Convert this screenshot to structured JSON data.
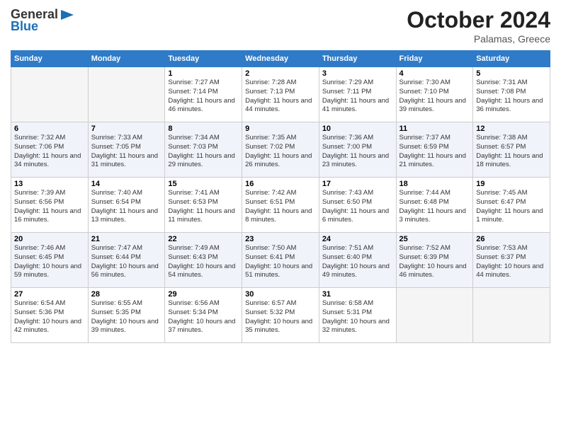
{
  "header": {
    "logo_line1": "General",
    "logo_line2": "Blue",
    "month": "October 2024",
    "location": "Palamas, Greece"
  },
  "days_of_week": [
    "Sunday",
    "Monday",
    "Tuesday",
    "Wednesday",
    "Thursday",
    "Friday",
    "Saturday"
  ],
  "weeks": [
    [
      {
        "day": "",
        "sunrise": "",
        "sunset": "",
        "daylight": ""
      },
      {
        "day": "",
        "sunrise": "",
        "sunset": "",
        "daylight": ""
      },
      {
        "day": "1",
        "sunrise": "Sunrise: 7:27 AM",
        "sunset": "Sunset: 7:14 PM",
        "daylight": "Daylight: 11 hours and 46 minutes."
      },
      {
        "day": "2",
        "sunrise": "Sunrise: 7:28 AM",
        "sunset": "Sunset: 7:13 PM",
        "daylight": "Daylight: 11 hours and 44 minutes."
      },
      {
        "day": "3",
        "sunrise": "Sunrise: 7:29 AM",
        "sunset": "Sunset: 7:11 PM",
        "daylight": "Daylight: 11 hours and 41 minutes."
      },
      {
        "day": "4",
        "sunrise": "Sunrise: 7:30 AM",
        "sunset": "Sunset: 7:10 PM",
        "daylight": "Daylight: 11 hours and 39 minutes."
      },
      {
        "day": "5",
        "sunrise": "Sunrise: 7:31 AM",
        "sunset": "Sunset: 7:08 PM",
        "daylight": "Daylight: 11 hours and 36 minutes."
      }
    ],
    [
      {
        "day": "6",
        "sunrise": "Sunrise: 7:32 AM",
        "sunset": "Sunset: 7:06 PM",
        "daylight": "Daylight: 11 hours and 34 minutes."
      },
      {
        "day": "7",
        "sunrise": "Sunrise: 7:33 AM",
        "sunset": "Sunset: 7:05 PM",
        "daylight": "Daylight: 11 hours and 31 minutes."
      },
      {
        "day": "8",
        "sunrise": "Sunrise: 7:34 AM",
        "sunset": "Sunset: 7:03 PM",
        "daylight": "Daylight: 11 hours and 29 minutes."
      },
      {
        "day": "9",
        "sunrise": "Sunrise: 7:35 AM",
        "sunset": "Sunset: 7:02 PM",
        "daylight": "Daylight: 11 hours and 26 minutes."
      },
      {
        "day": "10",
        "sunrise": "Sunrise: 7:36 AM",
        "sunset": "Sunset: 7:00 PM",
        "daylight": "Daylight: 11 hours and 23 minutes."
      },
      {
        "day": "11",
        "sunrise": "Sunrise: 7:37 AM",
        "sunset": "Sunset: 6:59 PM",
        "daylight": "Daylight: 11 hours and 21 minutes."
      },
      {
        "day": "12",
        "sunrise": "Sunrise: 7:38 AM",
        "sunset": "Sunset: 6:57 PM",
        "daylight": "Daylight: 11 hours and 18 minutes."
      }
    ],
    [
      {
        "day": "13",
        "sunrise": "Sunrise: 7:39 AM",
        "sunset": "Sunset: 6:56 PM",
        "daylight": "Daylight: 11 hours and 16 minutes."
      },
      {
        "day": "14",
        "sunrise": "Sunrise: 7:40 AM",
        "sunset": "Sunset: 6:54 PM",
        "daylight": "Daylight: 11 hours and 13 minutes."
      },
      {
        "day": "15",
        "sunrise": "Sunrise: 7:41 AM",
        "sunset": "Sunset: 6:53 PM",
        "daylight": "Daylight: 11 hours and 11 minutes."
      },
      {
        "day": "16",
        "sunrise": "Sunrise: 7:42 AM",
        "sunset": "Sunset: 6:51 PM",
        "daylight": "Daylight: 11 hours and 8 minutes."
      },
      {
        "day": "17",
        "sunrise": "Sunrise: 7:43 AM",
        "sunset": "Sunset: 6:50 PM",
        "daylight": "Daylight: 11 hours and 6 minutes."
      },
      {
        "day": "18",
        "sunrise": "Sunrise: 7:44 AM",
        "sunset": "Sunset: 6:48 PM",
        "daylight": "Daylight: 11 hours and 3 minutes."
      },
      {
        "day": "19",
        "sunrise": "Sunrise: 7:45 AM",
        "sunset": "Sunset: 6:47 PM",
        "daylight": "Daylight: 11 hours and 1 minute."
      }
    ],
    [
      {
        "day": "20",
        "sunrise": "Sunrise: 7:46 AM",
        "sunset": "Sunset: 6:45 PM",
        "daylight": "Daylight: 10 hours and 59 minutes."
      },
      {
        "day": "21",
        "sunrise": "Sunrise: 7:47 AM",
        "sunset": "Sunset: 6:44 PM",
        "daylight": "Daylight: 10 hours and 56 minutes."
      },
      {
        "day": "22",
        "sunrise": "Sunrise: 7:49 AM",
        "sunset": "Sunset: 6:43 PM",
        "daylight": "Daylight: 10 hours and 54 minutes."
      },
      {
        "day": "23",
        "sunrise": "Sunrise: 7:50 AM",
        "sunset": "Sunset: 6:41 PM",
        "daylight": "Daylight: 10 hours and 51 minutes."
      },
      {
        "day": "24",
        "sunrise": "Sunrise: 7:51 AM",
        "sunset": "Sunset: 6:40 PM",
        "daylight": "Daylight: 10 hours and 49 minutes."
      },
      {
        "day": "25",
        "sunrise": "Sunrise: 7:52 AM",
        "sunset": "Sunset: 6:39 PM",
        "daylight": "Daylight: 10 hours and 46 minutes."
      },
      {
        "day": "26",
        "sunrise": "Sunrise: 7:53 AM",
        "sunset": "Sunset: 6:37 PM",
        "daylight": "Daylight: 10 hours and 44 minutes."
      }
    ],
    [
      {
        "day": "27",
        "sunrise": "Sunrise: 6:54 AM",
        "sunset": "Sunset: 5:36 PM",
        "daylight": "Daylight: 10 hours and 42 minutes."
      },
      {
        "day": "28",
        "sunrise": "Sunrise: 6:55 AM",
        "sunset": "Sunset: 5:35 PM",
        "daylight": "Daylight: 10 hours and 39 minutes."
      },
      {
        "day": "29",
        "sunrise": "Sunrise: 6:56 AM",
        "sunset": "Sunset: 5:34 PM",
        "daylight": "Daylight: 10 hours and 37 minutes."
      },
      {
        "day": "30",
        "sunrise": "Sunrise: 6:57 AM",
        "sunset": "Sunset: 5:32 PM",
        "daylight": "Daylight: 10 hours and 35 minutes."
      },
      {
        "day": "31",
        "sunrise": "Sunrise: 6:58 AM",
        "sunset": "Sunset: 5:31 PM",
        "daylight": "Daylight: 10 hours and 32 minutes."
      },
      {
        "day": "",
        "sunrise": "",
        "sunset": "",
        "daylight": ""
      },
      {
        "day": "",
        "sunrise": "",
        "sunset": "",
        "daylight": ""
      }
    ]
  ]
}
